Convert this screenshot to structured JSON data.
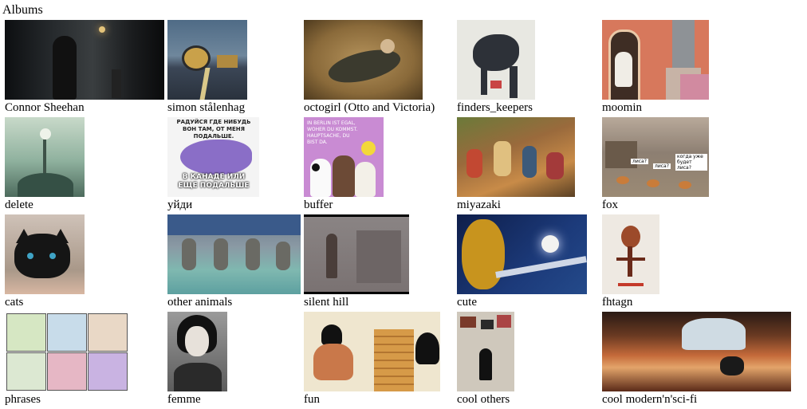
{
  "page": {
    "title": "Albums"
  },
  "albums": [
    {
      "name": "Connor Sheehan",
      "thumb": "dark-forest-figure"
    },
    {
      "name": "simon stålenhag",
      "thumb": "road-machines"
    },
    {
      "name": "octogirl (Otto and Victoria)",
      "thumb": "reclining-octopus-girl"
    },
    {
      "name": "finders_keepers",
      "thumb": "sketch-creature"
    },
    {
      "name": "moomin",
      "thumb": "moomin-room"
    },
    {
      "name": "delete",
      "thumb": "teal-tentacles"
    },
    {
      "name": "уйди",
      "thumb": "purple-whale-meme",
      "text_top": "РАДУЙСЯ ГДЕ НИБУДЬ ВОН ТАМ, ОТ МЕНЯ ПОДАЛЬШЕ.",
      "text_bottom": "В КАНАДЕ ИЛИ ЕЩЕ ПОДАЛЬШЕ"
    },
    {
      "name": "buffer",
      "thumb": "bears-poster",
      "text": "IN BERLIN IST EGAL, WOHER DU KOMMST. HAUPTSACHE, DU BIST DA."
    },
    {
      "name": "miyazaki",
      "thumb": "market-crowd"
    },
    {
      "name": "fox",
      "thumb": "fox-meme",
      "bubbles": [
        "лиса?",
        "лиса?",
        "когда уже будет лиса?"
      ]
    },
    {
      "name": "cats",
      "thumb": "black-kitten"
    },
    {
      "name": "other animals",
      "thumb": "seal-pool"
    },
    {
      "name": "silent hill",
      "thumb": "foggy-figure"
    },
    {
      "name": "cute",
      "thumb": "night-moon-creature"
    },
    {
      "name": "fhtagn",
      "thumb": "cthulhu-sketch"
    },
    {
      "name": "phrases",
      "thumb": "cat-comic"
    },
    {
      "name": "femme",
      "thumb": "vintage-portrait"
    },
    {
      "name": "fun",
      "thumb": "jenga-cartoon"
    },
    {
      "name": "cool others",
      "thumb": "paper-collage"
    },
    {
      "name": "cool modern'n'sci-fi",
      "thumb": "desert-canyon"
    }
  ]
}
